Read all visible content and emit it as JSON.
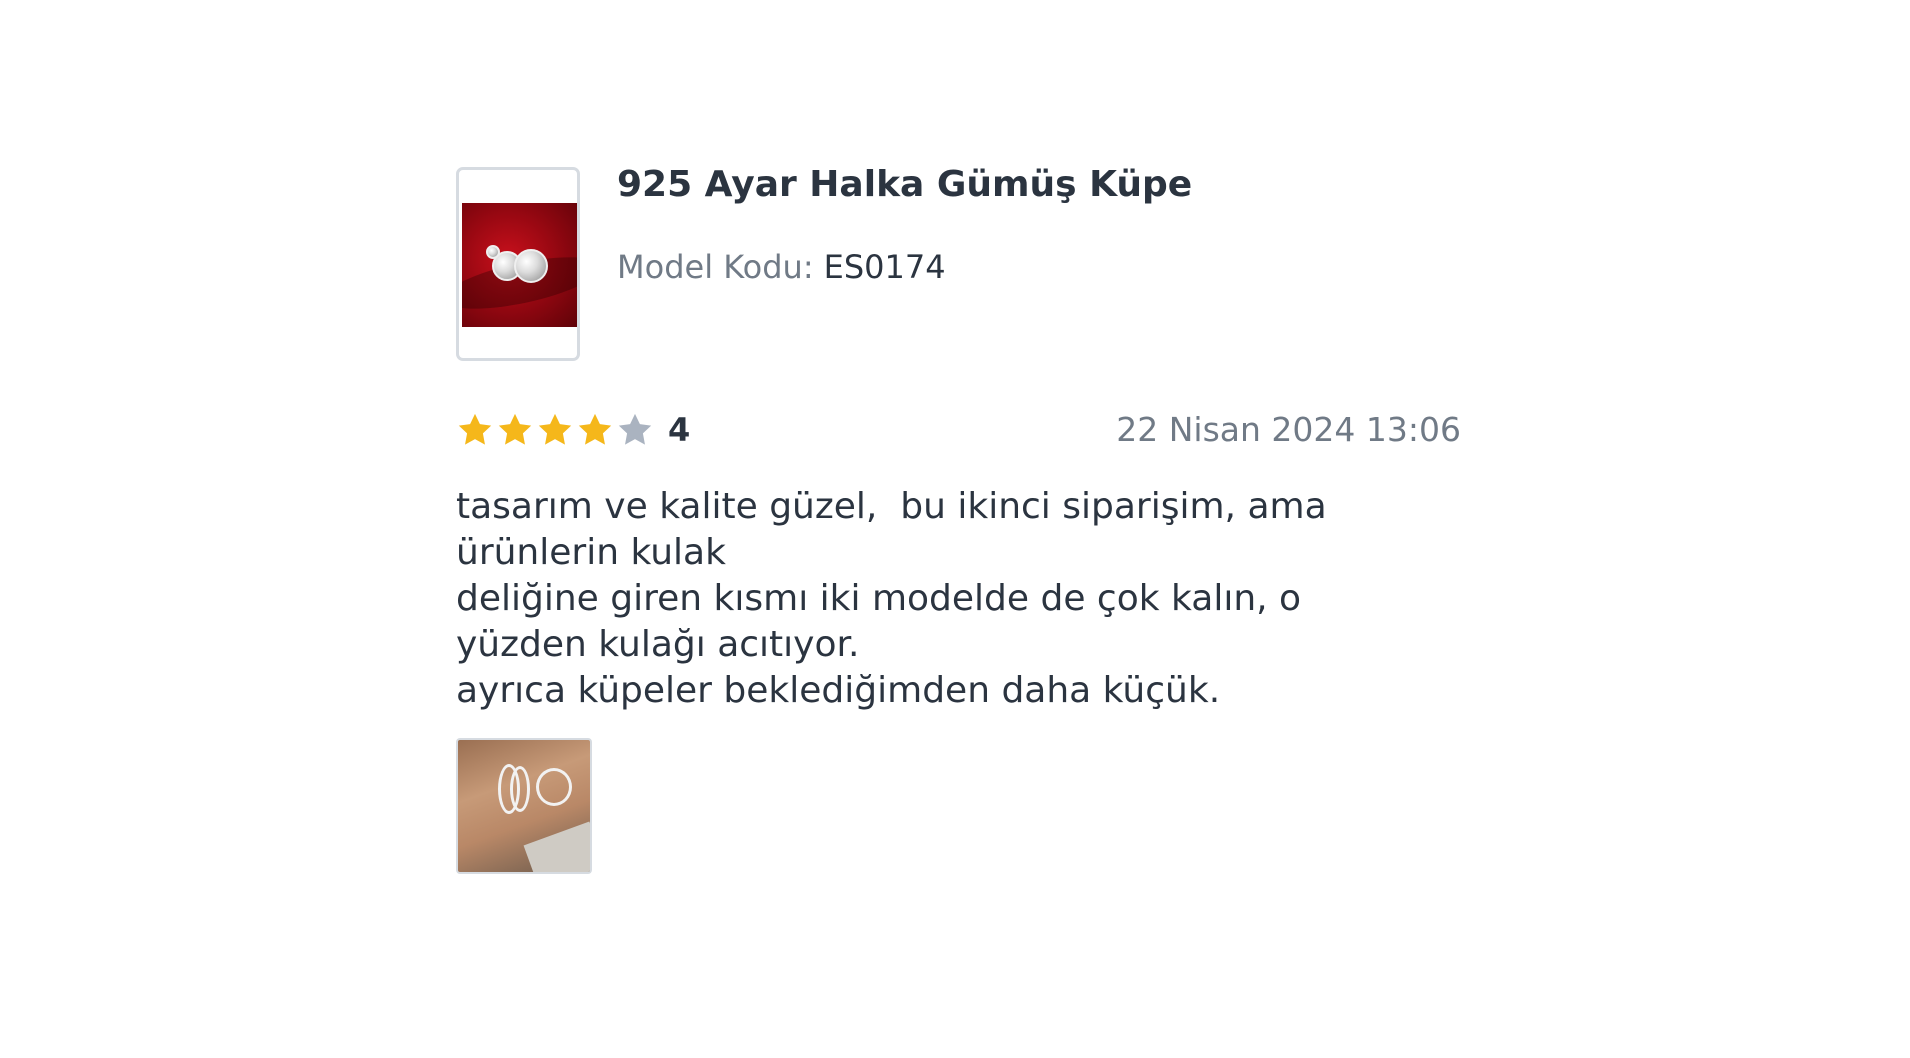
{
  "product": {
    "title": "925 Ayar Halka Gümüş Küpe",
    "model_label": "Model Kodu:",
    "model_value": "ES0174"
  },
  "review": {
    "rating_value": "4",
    "rating": 4,
    "rating_max": 5,
    "date": "22 Nisan 2024 13:06",
    "text_lines": [
      "tasarım ve kalite güzel,  bu ikinci siparişim, ama",
      "ürünlerin kulak",
      "deliğine giren kısmı iki modelde de çok kalın, o",
      "yüzden kulağı acıtıyor.",
      "ayrıca küpeler beklediğimden daha küçük."
    ]
  },
  "colors": {
    "star_filled": "#f5b71a",
    "star_empty": "#aab3c0",
    "text_primary": "#2b3440",
    "text_muted": "#707a86"
  },
  "icons": {
    "star": "star-icon"
  }
}
